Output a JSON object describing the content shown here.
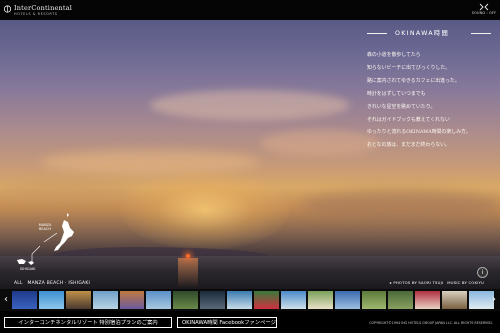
{
  "brand": {
    "name": "InterContinental",
    "tagline": "HOTELS & RESORTS"
  },
  "sound": {
    "label": "SOUND : OFF"
  },
  "panel": {
    "title": "OKINAWA時間",
    "lines": [
      "森の小道を散歩してたら",
      "知らないビーチに出てびっくりした。",
      "路に案内されてゆきるカフェに出逢った。",
      "時計をはずしていつまでも",
      "きれいな星空を眺めていたり。",
      "それはガイドブックも教えてくれない",
      "ゆったりと流れるOKINAWA時間の楽しみ方。",
      "おとなの旅は、まだまだ終わらない。"
    ]
  },
  "map": {
    "labels": [
      "MANZA BEACH",
      "ISHIGAKI"
    ]
  },
  "caption": {
    "left": "ALL　MANZA BEACH · ISHIGAKI",
    "right": "▸ PHOTOS BY SAORI TSUJI　MUSIC BY COKIYU"
  },
  "filmstrip": {
    "prev_icon": "chevron-left-icon",
    "next_icon": "chevron-right-icon",
    "thumbs": [
      {
        "colors": [
          "#1d3a8a",
          "#3c63c0"
        ]
      },
      {
        "colors": [
          "#3c8fd0",
          "#8ec8ea"
        ]
      },
      {
        "colors": [
          "#c0904a",
          "#4a3a30"
        ]
      },
      {
        "colors": [
          "#6fa0c8",
          "#b8d4e4"
        ]
      },
      {
        "colors": [
          "#c07a40",
          "#6a5aa0"
        ]
      },
      {
        "colors": [
          "#5a90c8",
          "#a8c8e0"
        ]
      },
      {
        "colors": [
          "#2e4a2a",
          "#6a8a4a"
        ]
      },
      {
        "colors": [
          "#1a2a3a",
          "#5a6a7a"
        ]
      },
      {
        "colors": [
          "#3a7ab0",
          "#c8dce8"
        ]
      },
      {
        "colors": [
          "#3a7a3a",
          "#d03040"
        ]
      },
      {
        "colors": [
          "#4a8ac8",
          "#cfe0ea"
        ]
      },
      {
        "colors": [
          "#7aa05a",
          "#e8e0c8"
        ]
      },
      {
        "colors": [
          "#3a6ab0",
          "#9cc0e0"
        ]
      },
      {
        "colors": [
          "#5a7a3a",
          "#a0b870"
        ]
      },
      {
        "colors": [
          "#4a6a3a",
          "#8aa060"
        ]
      },
      {
        "colors": [
          "#b03040",
          "#e8d0c0"
        ]
      },
      {
        "colors": [
          "#d8d0c0",
          "#7a6040"
        ]
      },
      {
        "colors": [
          "#8ab8e0",
          "#e0eaf0"
        ]
      }
    ]
  },
  "footer": {
    "button1": "インターコンチネンタルリゾート 特別宿泊プランのご案内",
    "button2": "OKINAWA時間 Facebookファンページ",
    "copyright": "COPYRIGHT©1994 IHG HOTELS GROUP JAPAN LLC. ALL RIGHTS RESERVED."
  },
  "colors": {
    "accent": "#ffffff",
    "background": "#000000"
  }
}
